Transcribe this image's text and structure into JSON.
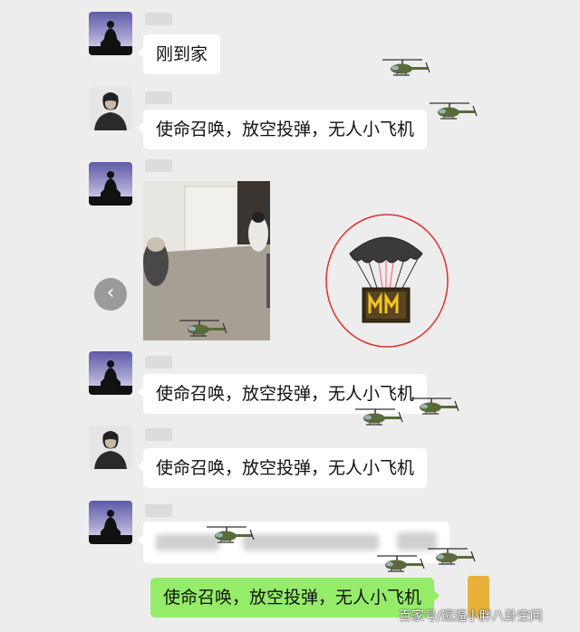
{
  "chat": {
    "messages": [
      {
        "sender": "other",
        "text": "刚到家"
      },
      {
        "sender": "other",
        "text": "使命召唤，放空投弹，无人小飞机"
      },
      {
        "sender": "other",
        "type": "image"
      },
      {
        "sender": "other",
        "text": "使命召唤，放空投弹，无人小飞机"
      },
      {
        "sender": "other",
        "text": "使命召唤，放空投弹，无人小飞机"
      },
      {
        "sender": "other",
        "type": "blurred"
      },
      {
        "sender": "me",
        "text": "使命召唤，放空投弹，无人小飞机"
      }
    ]
  },
  "back_button": {
    "glyph": "‹"
  },
  "watermark": {
    "text": "百家号/逗逼小胖八卦空间"
  },
  "colors": {
    "background": "#ededed",
    "bubble_other": "#ffffff",
    "bubble_me": "#95ec69",
    "airdrop_circle": "#e0302a"
  },
  "icons": [
    "buddha-avatar-icon",
    "man-avatar-icon",
    "helicopter-icon",
    "airdrop-crate-icon",
    "back-arrow-icon"
  ]
}
